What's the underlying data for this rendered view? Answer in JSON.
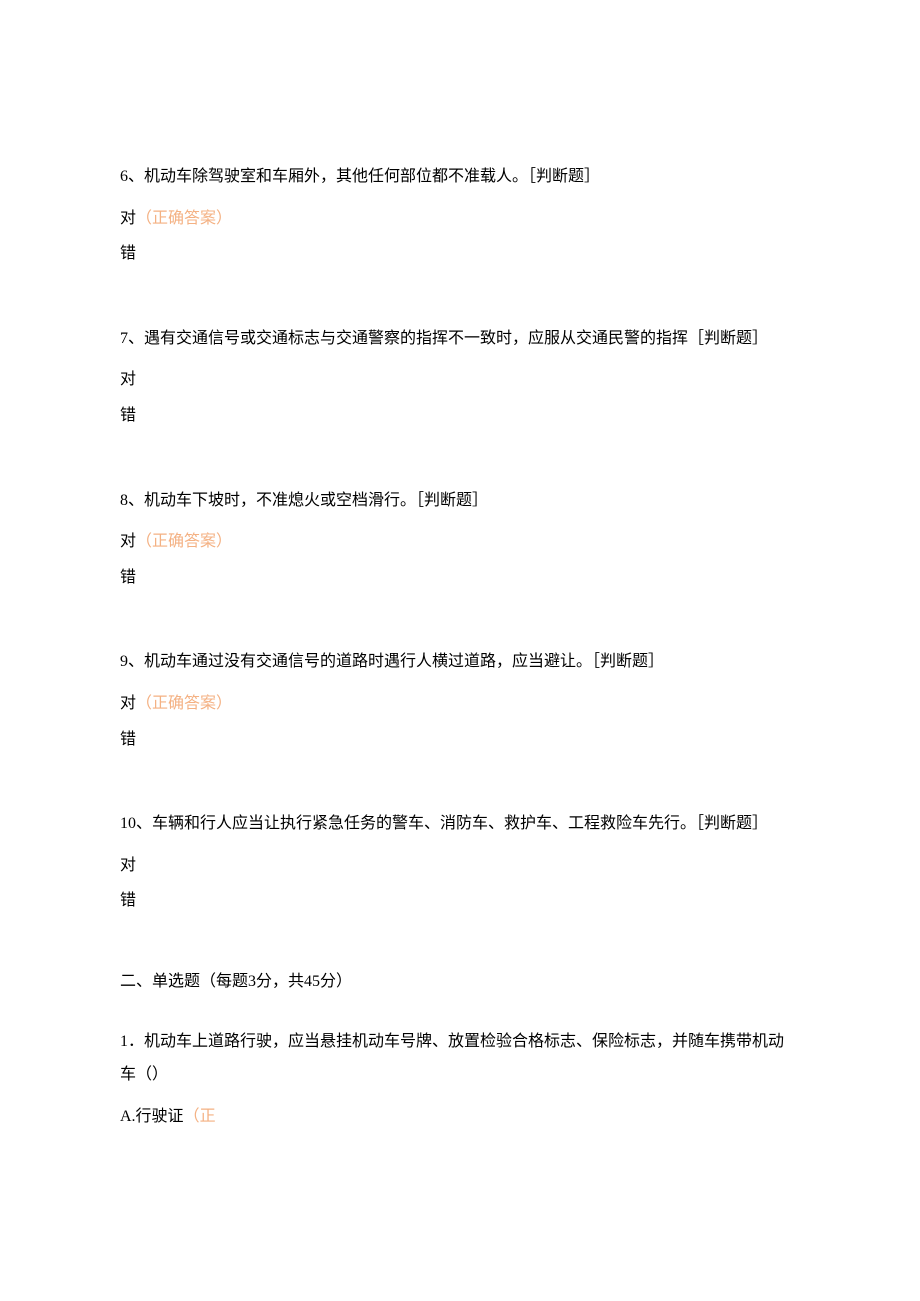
{
  "questions": [
    {
      "number": "6、",
      "text": "机动车除驾驶室和车厢外，其他任何部位都不准载人。［判断题］",
      "option1_prefix": "对",
      "option1_marker": "（正确答案）",
      "option2": "错"
    },
    {
      "number": "7、",
      "text": "遇有交通信号或交通标志与交通警察的指挥不一致时，应服从交通民警的指挥［判断题］",
      "option1_prefix": "对",
      "option1_marker": "",
      "option2": "错"
    },
    {
      "number": "8、",
      "text": "机动车下坡时，不准熄火或空档滑行。［判断题］",
      "option1_prefix": "对",
      "option1_marker": "（正确答案）",
      "option2": "错"
    },
    {
      "number": "9、",
      "text": "机动车通过没有交通信号的道路时遇行人横过道路，应当避让。［判断题］",
      "option1_prefix": "对",
      "option1_marker": "（正确答案）",
      "option2": "错"
    },
    {
      "number": "10、",
      "text": "车辆和行人应当让执行紧急任务的警车、消防车、救护车、工程救险车先行。［判断题］",
      "option1_prefix": "对",
      "option1_marker": "",
      "option2": "错"
    }
  ],
  "section2_header": "二、单选题（每题3分，共45分）",
  "mc_question": {
    "number": "1．",
    "text": "机动车上道路行驶，应当悬挂机动车号牌、放置检验合格标志、保险标志，并随车携带机动车（）",
    "optionA_prefix": "A.行驶证",
    "optionA_marker": "（正"
  }
}
